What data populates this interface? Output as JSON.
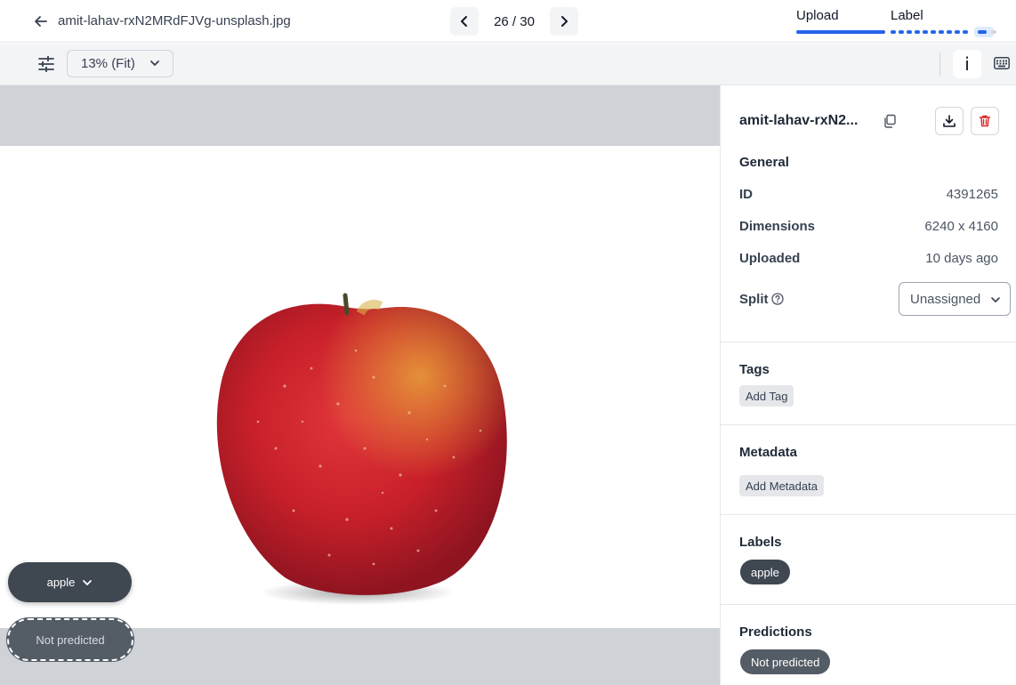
{
  "header": {
    "filename": "amit-lahav-rxN2MRdFJVg-unsplash.jpg",
    "counter": "26 / 30",
    "steps": {
      "upload": "Upload",
      "label": "Label"
    }
  },
  "toolbar": {
    "zoom": "13% (Fit)",
    "info_glyph": "i"
  },
  "canvas": {
    "class_pill": "apple",
    "prediction_pill": "Not predicted"
  },
  "panel": {
    "title": "amit-lahav-rxN2...",
    "general": {
      "heading": "General",
      "id_label": "ID",
      "id_value": "4391265",
      "dims_label": "Dimensions",
      "dims_value": "6240 x 4160",
      "uploaded_label": "Uploaded",
      "uploaded_value": "10 days ago",
      "split_label": "Split",
      "split_value": "Unassigned"
    },
    "tags": {
      "heading": "Tags",
      "add": "Add Tag"
    },
    "metadata": {
      "heading": "Metadata",
      "add": "Add Metadata"
    },
    "labels": {
      "heading": "Labels",
      "items": [
        "apple"
      ]
    },
    "predictions": {
      "heading": "Predictions",
      "value": "Not predicted"
    }
  },
  "colors": {
    "accent": "#2563eb",
    "delete": "#dc2626",
    "pill": "#3f4751"
  },
  "icons": [
    "back-arrow-icon",
    "chevron-left-icon",
    "chevron-right-icon",
    "sliders-icon",
    "chevron-down-icon",
    "info-icon",
    "keyboard-icon",
    "copy-icon",
    "download-icon",
    "trash-icon",
    "help-circle-icon"
  ]
}
